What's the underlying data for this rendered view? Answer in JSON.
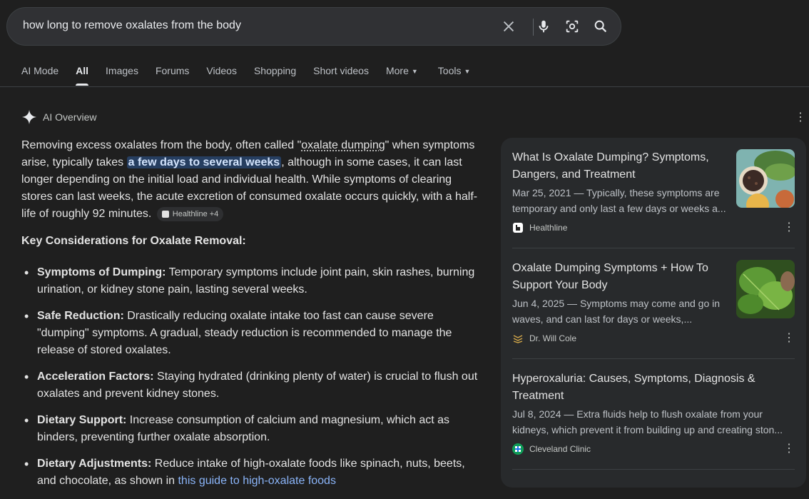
{
  "search": {
    "query": "how long to remove oxalates from the body"
  },
  "tabs": [
    {
      "label": "AI Mode"
    },
    {
      "label": "All"
    },
    {
      "label": "Images"
    },
    {
      "label": "Forums"
    },
    {
      "label": "Videos"
    },
    {
      "label": "Shopping"
    },
    {
      "label": "Short videos"
    },
    {
      "label": "More"
    },
    {
      "label": "Tools"
    }
  ],
  "overview": {
    "title": "AI Overview",
    "summary": {
      "p1": "Removing excess oxalates from the body, often called \"",
      "link": "oxalate dumping",
      "p2": "\" when symptoms arise, typically takes ",
      "highlight": "a few days to several weeks",
      "p3": ", although in some cases, it can last longer depending on the initial load and individual health. While symptoms of clearing stores can last weeks, the acute excretion of consumed oxalate occurs quickly, with a half-life of roughly 92 minutes.",
      "chip": "Healthline +4"
    },
    "key_title": "Key Considerations for Oxalate Removal:",
    "points": [
      {
        "label": "Symptoms of Dumping:",
        "text": " Temporary symptoms include joint pain, skin rashes, burning urination, or kidney stone pain, lasting several weeks."
      },
      {
        "label": "Safe Reduction:",
        "text": " Drastically reducing oxalate intake too fast can cause severe \"dumping\" symptoms. A gradual, steady reduction is recommended to manage the release of stored oxalates."
      },
      {
        "label": "Acceleration Factors:",
        "text": " Staying hydrated (drinking plenty of water) is crucial to flush out oxalates and prevent kidney stones."
      },
      {
        "label": "Dietary Support:",
        "text": " Increase consumption of calcium and magnesium, which act as binders, preventing further oxalate absorption."
      },
      {
        "label": "Dietary Adjustments:",
        "text": " Reduce intake of high-oxalate foods like spinach, nuts, beets, and chocolate, as shown in ",
        "link": "this guide to high-oxalate foods"
      }
    ]
  },
  "sources": [
    {
      "title": "What Is Oxalate Dumping? Symptoms, Dangers, and Treatment",
      "desc": "Mar 25, 2021 — Typically, these symptoms are temporary and only last a few days or weeks a...",
      "site": "Healthline"
    },
    {
      "title": "Oxalate Dumping Symptoms + How To Support Your Body",
      "desc": "Jun 4, 2025 — Symptoms may come and go in waves, and can last for days or weeks,...",
      "site": "Dr. Will Cole"
    },
    {
      "title": "Hyperoxaluria: Causes, Symptoms, Diagnosis & Treatment",
      "desc": "Jul 8, 2024 — Extra fluids help to flush oxalate from your kidneys, which prevent it from building up and creating ston...",
      "site": "Cleveland Clinic"
    }
  ]
}
